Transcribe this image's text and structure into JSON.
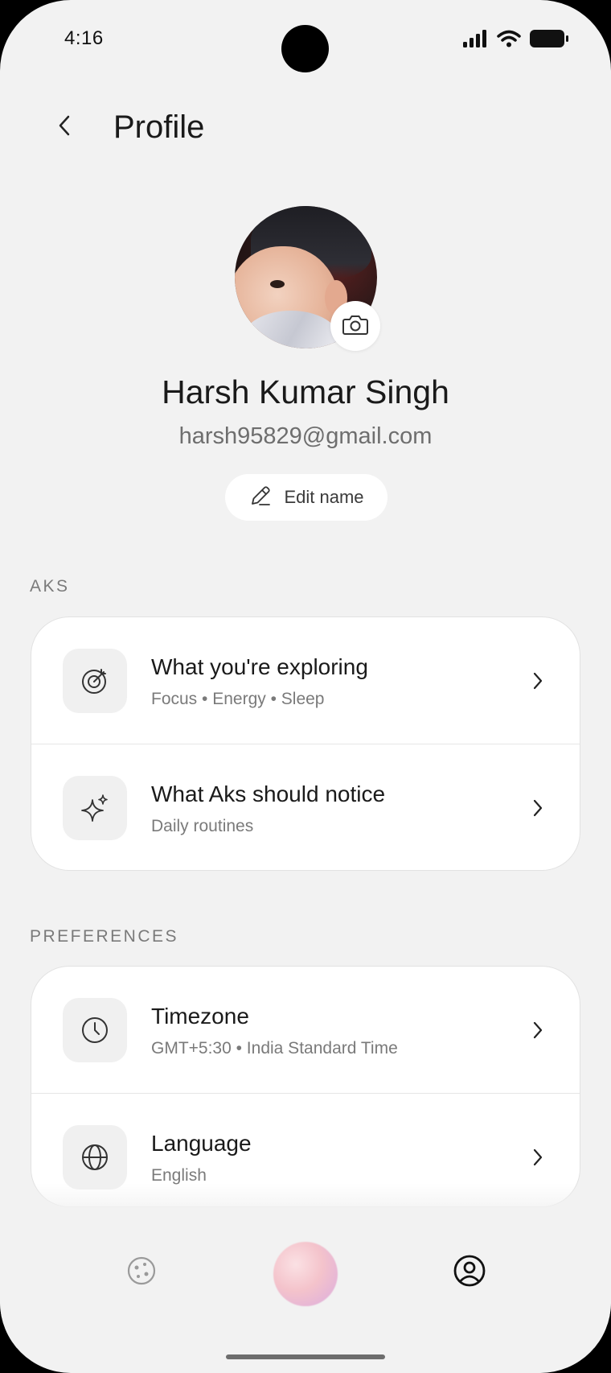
{
  "status_bar": {
    "time": "4:16",
    "icons": [
      "signal-icon",
      "wifi-icon",
      "battery-icon"
    ]
  },
  "header": {
    "title": "Profile",
    "back_icon": "chevron-left-icon"
  },
  "profile": {
    "name": "Harsh Kumar Singh",
    "email": "harsh95829@gmail.com",
    "edit_label": "Edit name",
    "camera_icon": "camera-icon",
    "edit_icon": "pencil-icon"
  },
  "sections": {
    "aks": {
      "label": "AKS",
      "items": [
        {
          "title": "What you're exploring",
          "subtitle": "Focus • Energy • Sleep",
          "icon": "target-icon"
        },
        {
          "title": "What Aks should notice",
          "subtitle": "Daily routines",
          "icon": "sparkle-icon"
        }
      ]
    },
    "preferences": {
      "label": "PREFERENCES",
      "items": [
        {
          "title": "Timezone",
          "subtitle": "GMT+5:30 • India Standard Time",
          "icon": "clock-icon"
        },
        {
          "title": "Language",
          "subtitle": "English",
          "icon": "globe-icon"
        }
      ]
    }
  },
  "nav": {
    "items": [
      "explore-icon",
      "aks-orb",
      "profile-icon"
    ],
    "active": "profile-icon"
  },
  "colors": {
    "background": "#f2f2f2",
    "card": "#ffffff",
    "text_primary": "#1a1a1a",
    "text_secondary": "#7a7a7a"
  }
}
